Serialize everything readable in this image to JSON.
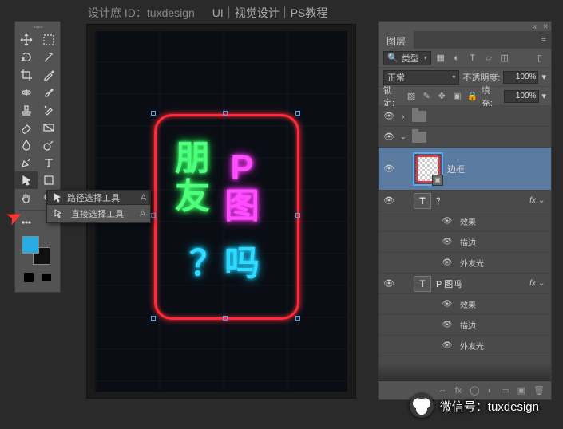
{
  "topbar": {
    "credit": "设计庶 ID：tuxdesign",
    "tags": "UI｜视觉设计｜PS教程"
  },
  "flyout": {
    "items": [
      {
        "label": "路径选择工具",
        "key": "A"
      },
      {
        "label": "直接选择工具",
        "key": "A"
      }
    ]
  },
  "canvas": {
    "neon1": "朋\n友",
    "neon2": "P\n图",
    "neon3": "？吗"
  },
  "panel": {
    "title": "图层",
    "filter_label": "类型",
    "blend": "正常",
    "opacity_label": "不透明度:",
    "opacity_val": "100%",
    "lock_label": "锁定:",
    "fill_label": "填充:",
    "fill_val": "100%",
    "layers": [
      {
        "kind": "folder",
        "name": ""
      },
      {
        "kind": "group-open",
        "name": ""
      },
      {
        "kind": "shape",
        "name": "边框",
        "active": true
      },
      {
        "kind": "text",
        "name": "？",
        "fx": true
      },
      {
        "kind": "fxchild",
        "name": "效果"
      },
      {
        "kind": "fxchild",
        "name": "描边"
      },
      {
        "kind": "fxchild",
        "name": "外发光"
      },
      {
        "kind": "text",
        "name": "P 图吗",
        "fx": true
      },
      {
        "kind": "fxchild",
        "name": "效果"
      },
      {
        "kind": "fxchild",
        "name": "描边"
      },
      {
        "kind": "fxchild",
        "name": "外发光"
      }
    ]
  },
  "watermark": {
    "text": "微信号：tuxdesign"
  }
}
